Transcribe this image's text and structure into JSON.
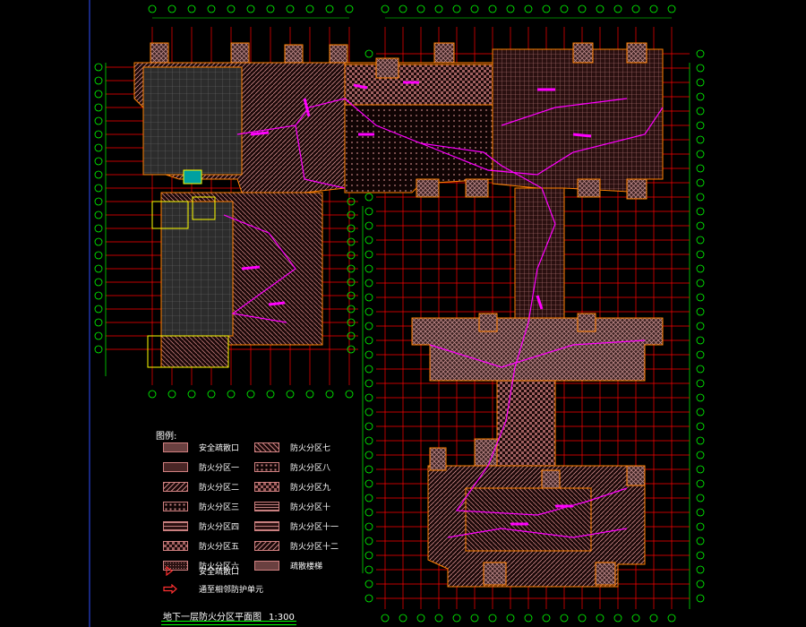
{
  "legend": {
    "title": "图例:",
    "items_left": [
      {
        "label": "安全疏散口",
        "pattern": "p-cross"
      },
      {
        "label": "防火分区一",
        "pattern": "p-dots"
      },
      {
        "label": "防火分区二",
        "pattern": "p-slash"
      },
      {
        "label": "防火分区三",
        "pattern": "p-sdots"
      },
      {
        "label": "防火分区四",
        "pattern": "p-grid"
      },
      {
        "label": "防火分区五",
        "pattern": "p-checker"
      },
      {
        "label": "防火分区六",
        "pattern": "p-fine"
      }
    ],
    "items_right": [
      {
        "label": "防火分区七",
        "pattern": "p-back"
      },
      {
        "label": "防火分区八",
        "pattern": "p-sdots"
      },
      {
        "label": "防火分区九",
        "pattern": "p-checker"
      },
      {
        "label": "防火分区十",
        "pattern": "p-hlines"
      },
      {
        "label": "防火分区十一",
        "pattern": "p-grid"
      },
      {
        "label": "防火分区十二",
        "pattern": "p-slash"
      },
      {
        "label": "疏散楼梯",
        "pattern": "p-cross"
      }
    ],
    "symbols": [
      {
        "label": "安全疏散口",
        "icon": "exit-flag-icon"
      },
      {
        "label": "通至相邻防护单元",
        "icon": "adjacent-unit-arrow-icon"
      }
    ]
  },
  "drawing_title": {
    "name": "地下一层防火分区平面图",
    "scale": "1:300"
  },
  "colors": {
    "background": "#000000",
    "axis_line": "#ff0000",
    "dimension": "#00ff00",
    "wall": "#ff8000",
    "hatch": "#c08080",
    "evacuation_route": "#ff00ff",
    "text": "#ffffff"
  }
}
